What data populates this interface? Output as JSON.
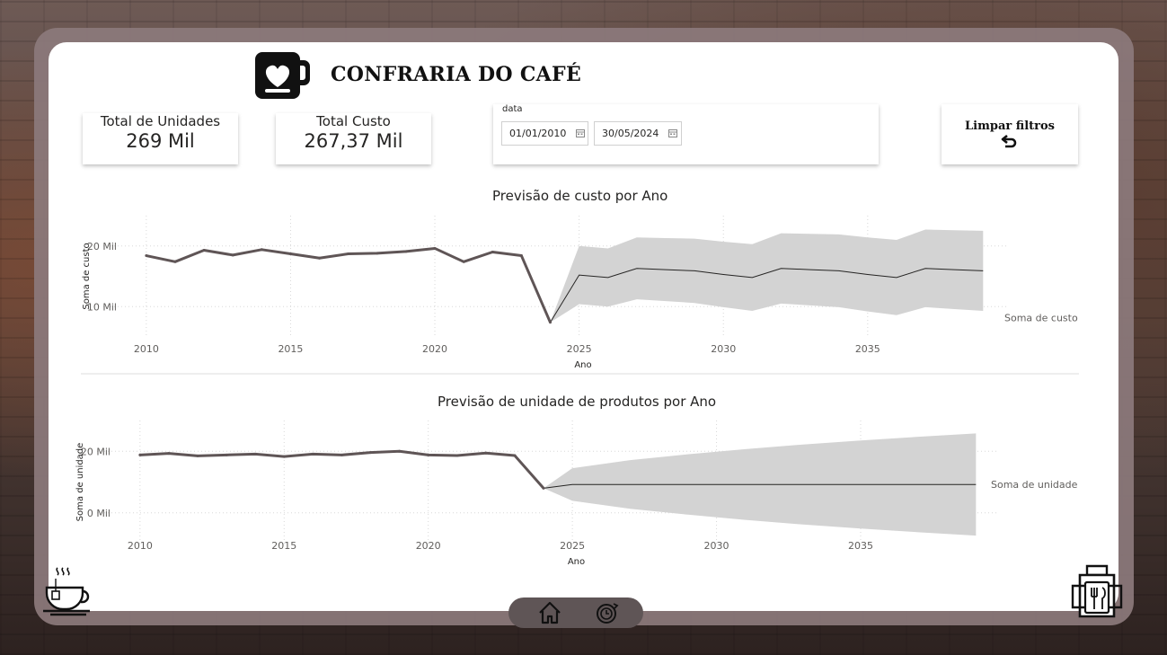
{
  "header": {
    "title": "CONFRARIA DO CAFÉ"
  },
  "kpis": [
    {
      "label": "Total de Unidades",
      "value": "269 Mil"
    },
    {
      "label": "Total Custo",
      "value": "267,37 Mil"
    }
  ],
  "date_filter": {
    "label": "data",
    "start": "01/01/2010",
    "end": "30/05/2024"
  },
  "clear_button": {
    "label": "Limpar filtros"
  },
  "icons": {
    "logo": "heart-mug-icon",
    "calendar": "calendar-icon",
    "undo": "undo-arrow-icon",
    "home": "home-icon",
    "forecast": "clock-refresh-icon",
    "coffee": "coffee-cup-icon",
    "food": "food-basket-icon"
  },
  "colors": {
    "line": "#5f5556",
    "band": "#d3d3d3",
    "forecast_line": "#252423",
    "frame": "#8c7a7c"
  },
  "chart_data": [
    {
      "type": "line",
      "title": "Previsão de custo por Ano",
      "xlabel": "Ano",
      "ylabel": "Soma de custo",
      "xlim": [
        2009.6,
        2039.8
      ],
      "ylim": [
        5,
        25
      ],
      "xticks": [
        2010,
        2015,
        2020,
        2025,
        2030,
        2035
      ],
      "yticks": [
        {
          "v": 10,
          "label": "10 Mil"
        },
        {
          "v": 20,
          "label": "20 Mil"
        }
      ],
      "grid": true,
      "series": [
        {
          "name": "Soma de custo",
          "x": [
            2010,
            2011,
            2012,
            2013,
            2014,
            2015,
            2016,
            2017,
            2018,
            2019,
            2020,
            2021,
            2022,
            2023,
            2024
          ],
          "values": [
            18.4,
            17.4,
            19.3,
            18.5,
            19.4,
            18.7,
            18.0,
            18.7,
            18.8,
            19.1,
            19.6,
            17.4,
            19.0,
            18.4,
            7.4
          ]
        }
      ],
      "forecast": {
        "x": [
          2024,
          2025,
          2026,
          2027,
          2028,
          2029,
          2030,
          2031,
          2032,
          2033,
          2034,
          2035,
          2036,
          2037,
          2038,
          2039
        ],
        "values": [
          7.4,
          15.2,
          14.8,
          16.3,
          16.1,
          15.9,
          15.3,
          14.8,
          16.3,
          16.1,
          15.9,
          15.3,
          14.8,
          16.3,
          16.1,
          15.9
        ],
        "upper": [
          7.4,
          20.0,
          19.6,
          21.4,
          21.3,
          21.2,
          20.7,
          20.3,
          22.1,
          22.0,
          21.9,
          21.4,
          21.0,
          22.7,
          22.6,
          22.5
        ],
        "lower": [
          7.4,
          10.4,
          10.0,
          11.2,
          10.9,
          10.6,
          9.9,
          9.3,
          10.5,
          10.2,
          9.9,
          9.2,
          8.6,
          9.9,
          9.6,
          9.3
        ]
      }
    },
    {
      "type": "line",
      "title": "Previsão de unidade de produtos por Ano",
      "xlabel": "Ano",
      "ylabel": "Soma de unidade",
      "xlim": [
        2009.6,
        2039.8
      ],
      "ylim": [
        -10,
        30
      ],
      "xticks": [
        2010,
        2015,
        2020,
        2025,
        2030,
        2035
      ],
      "yticks": [
        {
          "v": 0,
          "label": "0 Mil"
        },
        {
          "v": 20,
          "label": "20 Mil"
        }
      ],
      "grid": true,
      "series": [
        {
          "name": "Soma de unidade",
          "x": [
            2010,
            2011,
            2012,
            2013,
            2014,
            2015,
            2016,
            2017,
            2018,
            2019,
            2020,
            2021,
            2022,
            2023,
            2024
          ],
          "values": [
            18.8,
            19.3,
            18.5,
            18.8,
            19.1,
            18.3,
            19.1,
            18.8,
            19.6,
            20.0,
            18.8,
            18.6,
            19.4,
            18.6,
            8.0
          ]
        }
      ],
      "forecast": {
        "x": [
          2024,
          2025,
          2027,
          2029,
          2031,
          2033,
          2035,
          2037,
          2039
        ],
        "values": [
          8.0,
          9.2,
          9.2,
          9.2,
          9.2,
          9.2,
          9.2,
          9.2,
          9.2
        ],
        "upper": [
          8.0,
          14.5,
          17.1,
          19.0,
          20.7,
          22.2,
          23.5,
          24.7,
          25.8
        ],
        "lower": [
          8.0,
          3.9,
          1.3,
          -0.6,
          -2.3,
          -3.8,
          -5.1,
          -6.3,
          -7.4
        ]
      }
    }
  ]
}
